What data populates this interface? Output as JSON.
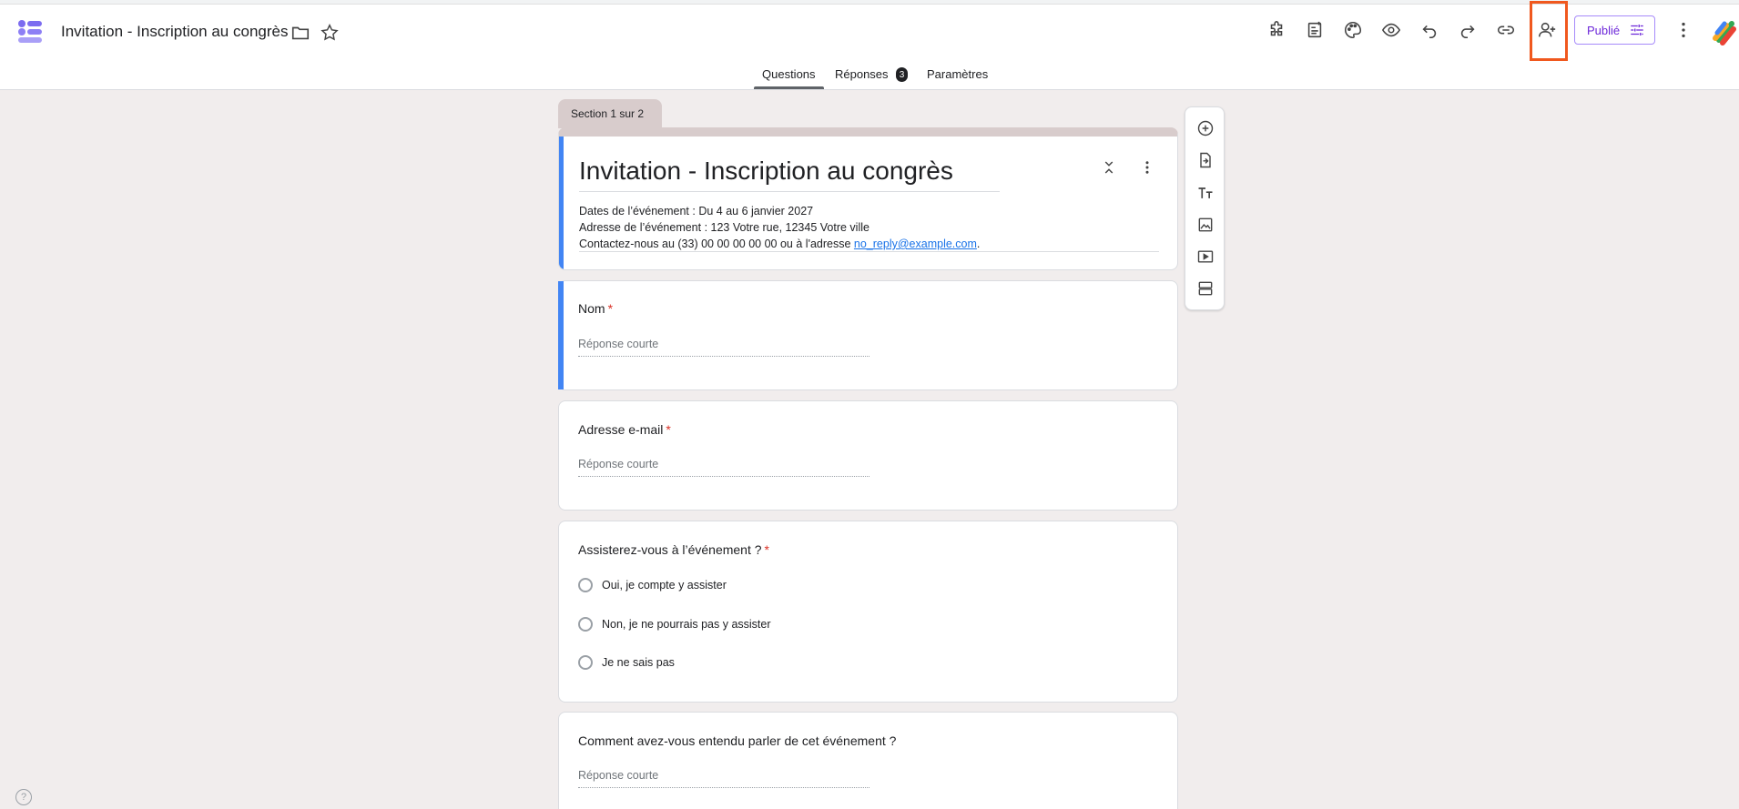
{
  "header": {
    "doc_title": "Invitation - Inscription au congrès",
    "publish_label": "Publié",
    "icons": [
      "folder-icon",
      "star-icon",
      "addon-icon",
      "mocked-ai-icon",
      "palette-icon",
      "preview-icon",
      "undo-icon",
      "redo-icon",
      "link-icon",
      "add-collaborator-icon",
      "publish-settings-icon",
      "more-vert-icon"
    ],
    "highlight_color": "#f0581e"
  },
  "tabs": {
    "questions": "Questions",
    "responses": "Réponses",
    "responses_count": "3",
    "settings": "Paramètres"
  },
  "section": {
    "label": "Section 1 sur 2"
  },
  "form": {
    "title": "Invitation - Inscription au congrès",
    "desc_line1": "Dates de l’événement : Du 4 au 6 janvier 2027",
    "desc_line2": "Adresse de l’événement : 123 Votre rue, 12345 Votre ville",
    "desc_line3_prefix": "Contactez-nous au (33) 00 00 00 00 00 ou à l'adresse ",
    "desc_email": "no_reply@example.com",
    "desc_line3_suffix": "."
  },
  "questions": [
    {
      "label": "Nom",
      "required": "*",
      "placeholder": "Réponse courte"
    },
    {
      "label": "Adresse e-mail",
      "required": "*",
      "placeholder": "Réponse courte"
    },
    {
      "label": "Assisterez-vous à l’événement ?",
      "required": "*",
      "options": [
        "Oui, je compte y assister",
        "Non, je ne pourrais pas y assister",
        "Je ne sais pas"
      ]
    },
    {
      "label": "Comment avez-vous entendu parler de cet événement ?",
      "placeholder": "Réponse courte"
    }
  ],
  "help": "?",
  "colors": {
    "accent": "#4285f4",
    "background": "#f1eded",
    "section": "#d8cccc",
    "publish": "#6d28d9"
  }
}
